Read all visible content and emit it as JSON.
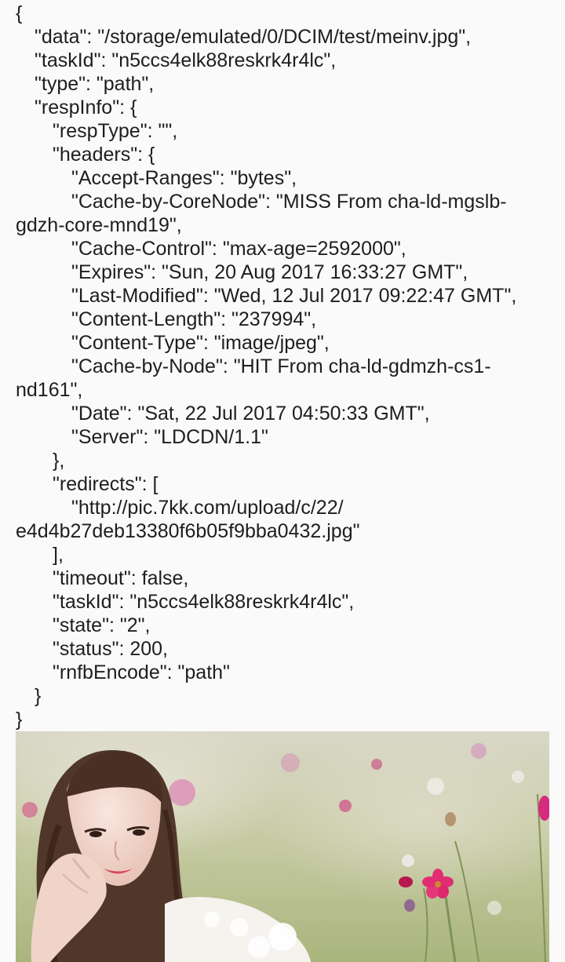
{
  "response_json_lines": [
    "{",
    "\"data\": \"/storage/emulated/0/DCIM/test/meinv.jpg\",",
    "\"taskId\": \"n5ccs4elk88reskrk4r4lc\",",
    "\"type\": \"path\",",
    "\"respInfo\": {",
    "\"respType\": \"\",",
    "\"headers\": {",
    "\"Accept-Ranges\": \"bytes\",",
    "\"Cache-by-CoreNode\": \"MISS From cha-ld-mgslb-",
    "gdzh-core-mnd19\",",
    "\"Cache-Control\": \"max-age=2592000\",",
    "\"Expires\": \"Sun, 20 Aug 2017 16:33:27 GMT\",",
    "\"Last-Modified\": \"Wed, 12 Jul 2017 09:22:47 GMT\",",
    "\"Content-Length\": \"237994\",",
    "\"Content-Type\": \"image/jpeg\",",
    "\"Cache-by-Node\": \"HIT From cha-ld-gdmzh-cs1-",
    "nd161\",",
    "\"Date\": \"Sat, 22 Jul 2017 04:50:33 GMT\",",
    "\"Server\": \"LDCDN/1.1\"",
    "},",
    "\"redirects\": [",
    "\"http://pic.7kk.com/upload/c/22/",
    "e4d4b27deb13380f6b05f9bba0432.jpg\"",
    "],",
    "\"timeout\": false,",
    "\"taskId\": \"n5ccs4elk88reskrk4r4lc\",",
    "\"state\": \"2\",",
    "\"status\": 200,",
    "\"rnfbEncode\": \"path\"",
    "}",
    "}"
  ],
  "colors": {
    "page_background": "#fafafa",
    "text": "#1e1e1e"
  },
  "image": {
    "subject_icon": "portrait-photo"
  }
}
